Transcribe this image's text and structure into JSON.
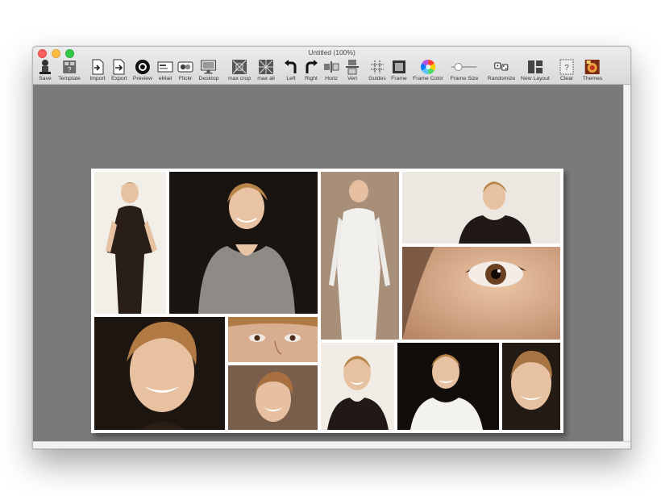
{
  "window": {
    "title": "Untitled (100%)"
  },
  "toolbar": {
    "items": [
      {
        "label": "Save",
        "icon": "save-icon"
      },
      {
        "label": "Template",
        "icon": "template-icon"
      },
      {
        "label": "Import",
        "icon": "import-icon"
      },
      {
        "label": "Export",
        "icon": "export-icon"
      },
      {
        "label": "Preview",
        "icon": "preview-icon"
      },
      {
        "label": "eMail",
        "icon": "email-icon"
      },
      {
        "label": "Flickr",
        "icon": "flickr-icon"
      },
      {
        "label": "Desktop",
        "icon": "desktop-icon"
      },
      {
        "label": "max crop",
        "icon": "max-crop-icon"
      },
      {
        "label": "max all",
        "icon": "max-all-icon"
      },
      {
        "label": "Left",
        "icon": "rotate-left-icon"
      },
      {
        "label": "Right",
        "icon": "rotate-right-icon"
      },
      {
        "label": "Horiz",
        "icon": "flip-horizontal-icon"
      },
      {
        "label": "Vert",
        "icon": "flip-vertical-icon"
      },
      {
        "label": "Guides",
        "icon": "guides-icon"
      },
      {
        "label": "Frame",
        "icon": "frame-icon"
      },
      {
        "label": "Frame Color",
        "icon": "color-wheel-icon"
      },
      {
        "label": "Frame Size",
        "icon": "frame-size-slider-icon"
      },
      {
        "label": "Randomize",
        "icon": "randomize-icon"
      },
      {
        "label": "New Layout",
        "icon": "new-layout-icon"
      },
      {
        "label": "Clear",
        "icon": "clear-icon"
      },
      {
        "label": "Themes",
        "icon": "themes-icon"
      }
    ]
  },
  "colors": {
    "workspace_bg": "#7a7a7a",
    "frame": "#ffffff",
    "photo_dark": "#1c1410",
    "photo_warm": "#c8b8a4"
  },
  "collage": {
    "photos": [
      {
        "name": "photo-full-body-dark-dress",
        "bg": "#f2eee8"
      },
      {
        "name": "photo-smiling-grey-top",
        "bg": "#1a1411"
      },
      {
        "name": "photo-standing-white-outfit",
        "bg": "#a88f7a"
      },
      {
        "name": "photo-portrait-bright-background",
        "bg": "#ece7e0"
      },
      {
        "name": "photo-eye-closeup",
        "bg": "#e0b89a"
      },
      {
        "name": "photo-laughing-closeup",
        "bg": "#1d1510"
      },
      {
        "name": "photo-eyes-crop",
        "bg": "#c99f82"
      },
      {
        "name": "photo-head-tilted",
        "bg": "#7a5e4c"
      },
      {
        "name": "photo-smile-black-top",
        "bg": "#f1ede6"
      },
      {
        "name": "photo-white-shirt-dark-bg",
        "bg": "#120d0a"
      },
      {
        "name": "photo-smile-closeup-dark",
        "bg": "#241a14"
      }
    ]
  }
}
